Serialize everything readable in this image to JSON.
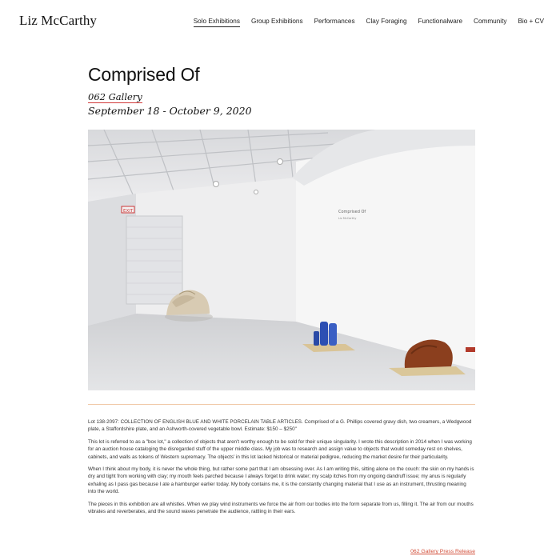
{
  "site": {
    "title": "Liz McCarthy"
  },
  "nav": {
    "items": [
      {
        "label": "Solo Exhibitions",
        "active": true
      },
      {
        "label": "Group Exhibitions",
        "active": false
      },
      {
        "label": "Performances",
        "active": false
      },
      {
        "label": "Clay Foraging",
        "active": false
      },
      {
        "label": "Functionalware",
        "active": false
      },
      {
        "label": "Community",
        "active": false
      },
      {
        "label": "Bio + CV",
        "active": false
      }
    ]
  },
  "exhibition": {
    "title": "Comprised Of",
    "venue": "062 Gallery",
    "dates": "September 18 - October 9, 2020",
    "image": {
      "wall_text_title": "Comprised Of",
      "wall_text_name": "Liz McCarthy",
      "exit_sign": "EXIT"
    },
    "paragraphs": [
      "Lot 138-2097: COLLECTION OF ENGLISH BLUE AND WHITE PORCELAIN TABLE ARTICLES. Comprised of a G. Phillips covered gravy dish, two creamers, a Wedgwood plate, a Staffordshire plate, and an Ashworth-covered vegetable bowl. Estimate: $150 – $250\"",
      "This lot is referred to as a \"box lot,\" a collection of objects that aren't worthy enough to be sold for their unique singularity. I wrote this description in 2014 when I was working for an auction house cataloging the disregarded stuff of the upper middle class. My job was to research and assign value to objects that would someday rest on shelves, cabinets, and walls as tokens of Western supremacy. The objects' in this lot lacked historical or material pedigree, reducing the market desire for their particularity.",
      "When I think about my body, it is never the whole thing, but rather some part that I am obsessing over. As I am writing this, sitting alone on the couch: the skin on my hands is dry and tight from working with clay; my mouth feels parched because I always forget to drink water; my scalp itches from my ongoing dandruff issue; my anus is regularly exhaling as I pass gas because I ate a hamburger earlier today. My body contains me, it is the constantly changing material that I use as an instrument, thrusting meaning into the world.",
      "The pieces in this exhibition are all whistles. When we play wind instruments we force the air from our bodies into the form separate from us, filling it. The air from our mouths vibrates and reverberates, and the sound waves penetrate the audience, rattling in their ears."
    ],
    "press_link": "062 Gallery Press Release"
  },
  "colors": {
    "accent": "#d24f3a",
    "divider": "#f0c9a8",
    "venue_underline": "#d23a3a"
  }
}
